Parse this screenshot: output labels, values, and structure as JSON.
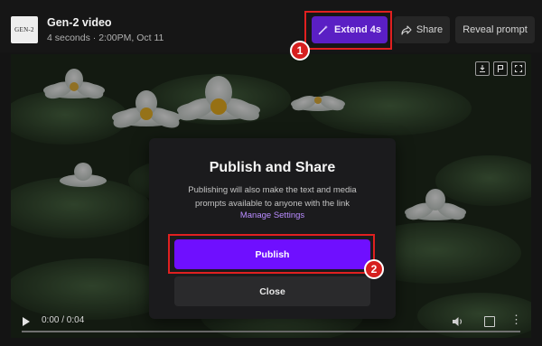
{
  "header": {
    "thumbnail_text": "GEN-2",
    "title": "Gen-2 video",
    "meta": "4 seconds · 2:00PM, Oct 11"
  },
  "toolbar": {
    "extend_label": "Extend 4s",
    "share_label": "Share",
    "reveal_label": "Reveal prompt"
  },
  "player": {
    "time": "0:00 / 0:04",
    "progress": 0
  },
  "modal": {
    "title": "Publish and Share",
    "description": "Publishing will also make the text and media prompts available to anyone with the link",
    "link": "Manage Settings",
    "publish_label": "Publish",
    "close_label": "Close"
  },
  "callouts": [
    "1",
    "2"
  ],
  "colors": {
    "accent": "#6f0fff",
    "extend_bg": "#5a1fc4",
    "callout": "#e02020"
  }
}
